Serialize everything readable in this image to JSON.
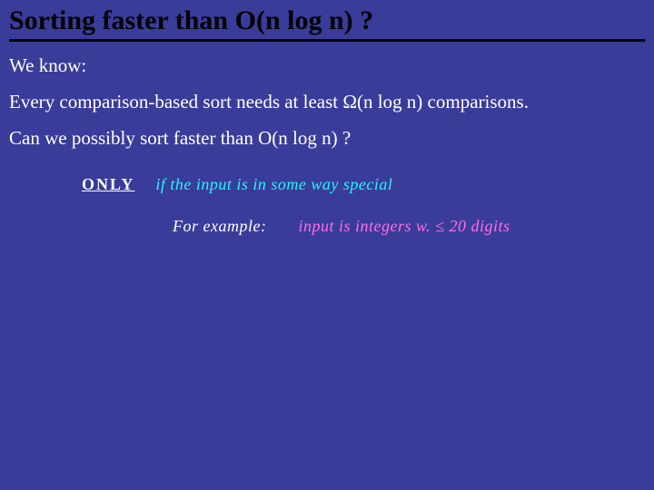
{
  "title": "Sorting faster than O(n log n) ?",
  "body": {
    "p1": "We know:",
    "p2": "Every comparison-based sort needs at least Ω(n log n) comparisons.",
    "p3": "Can we possibly sort faster than O(n log n) ?"
  },
  "hand": {
    "only": "ONLY",
    "line1_rest": "if the input is in some way special",
    "example_label": "For example:",
    "line2_rest": "input is integers w. ≤ 20 digits"
  }
}
